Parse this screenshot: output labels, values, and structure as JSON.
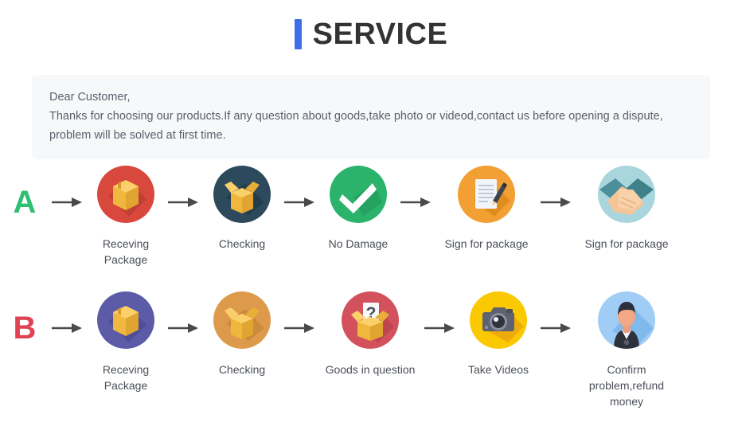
{
  "header": {
    "title": "SERVICE",
    "accent_color": "#3f6fe8"
  },
  "notice": {
    "line1": "Dear Customer,",
    "line2": "Thanks for choosing our products.If any question about goods,take photo or videod,contact us before opening a dispute,",
    "line3": "problem will be solved at first time.",
    "background_color": "#f7f8fa"
  },
  "flows": [
    {
      "letter": "A",
      "letter_color": "#2fbf71",
      "steps": [
        {
          "label": "Receving Package",
          "icon": "closed-box-icon",
          "circle_color": "#d8483c"
        },
        {
          "label": "Checking",
          "icon": "open-box-icon",
          "circle_color": "#2c4a5c"
        },
        {
          "label": "No Damage",
          "icon": "check-mark-icon",
          "circle_color": "#2cb36b"
        },
        {
          "label": "Sign for package",
          "icon": "document-pen-icon",
          "circle_color": "#f2a033"
        },
        {
          "label": "Sign for package",
          "icon": "handshake-icon",
          "circle_color": "#a9d6dd"
        }
      ]
    },
    {
      "letter": "B",
      "letter_color": "#e04252",
      "steps": [
        {
          "label": "Receving Package",
          "icon": "closed-box-icon",
          "circle_color": "#5b5ba8"
        },
        {
          "label": "Checking",
          "icon": "open-box-icon",
          "circle_color": "#dd9a4b"
        },
        {
          "label": "Goods in question",
          "icon": "question-box-icon",
          "circle_color": "#d2515c"
        },
        {
          "label": "Take Videos",
          "icon": "camera-icon",
          "circle_color": "#fbc902"
        },
        {
          "label": "Confirm  problem,refund money",
          "icon": "person-icon",
          "circle_color": "#9fcdf5"
        }
      ]
    }
  ],
  "arrow": {
    "name": "arrow-right-icon",
    "color": "#4a4a4a"
  }
}
